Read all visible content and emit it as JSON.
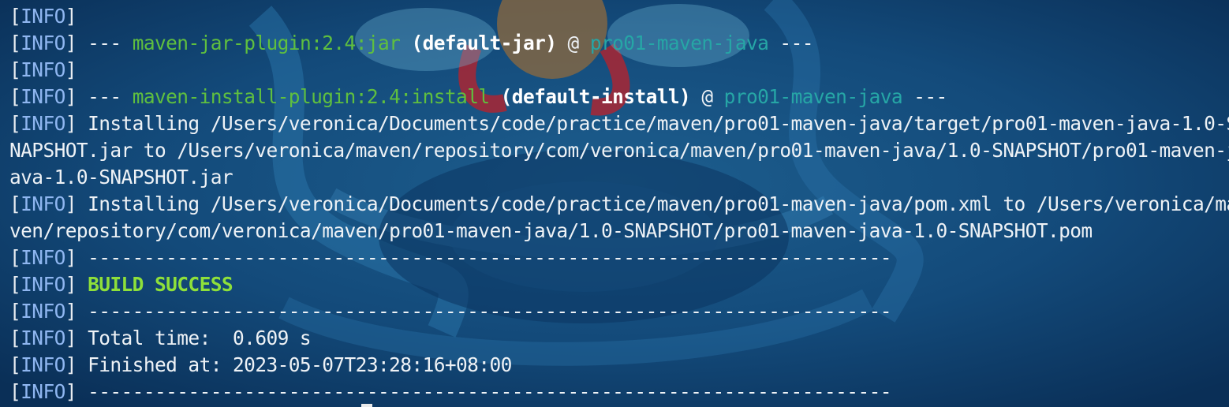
{
  "colors": {
    "background": "#0d3a66",
    "text": "#eef2f6",
    "info_level": "#8fb6f0",
    "plugin_green": "#5fbf3f",
    "project_cyan": "#26a6a6",
    "success_green": "#8ee03a"
  },
  "terminal": {
    "lines": [
      {
        "kind": "info",
        "level": "INFO",
        "text": ""
      },
      {
        "kind": "plugin",
        "level": "INFO",
        "dashes_open": " --- ",
        "plugin": "maven-jar-plugin:2.4:jar",
        "goal": " (default-jar)",
        "at": " @ ",
        "project": "pro01-maven-java",
        "dashes_close": " ---"
      },
      {
        "kind": "info",
        "level": "INFO",
        "text": ""
      },
      {
        "kind": "plugin",
        "level": "INFO",
        "dashes_open": " --- ",
        "plugin": "maven-install-plugin:2.4:install",
        "goal": " (default-install)",
        "at": " @ ",
        "project": "pro01-maven-java",
        "dashes_close": " ---"
      },
      {
        "kind": "info",
        "level": "INFO",
        "text": " Installing /Users/veronica/Documents/code/practice/maven/pro01-maven-java/target/pro01-maven-java-1.0-S"
      },
      {
        "kind": "plain",
        "text": "NAPSHOT.jar to /Users/veronica/maven/repository/com/veronica/maven/pro01-maven-java/1.0-SNAPSHOT/pro01-maven-j"
      },
      {
        "kind": "plain",
        "text": "ava-1.0-SNAPSHOT.jar"
      },
      {
        "kind": "info",
        "level": "INFO",
        "text": " Installing /Users/veronica/Documents/code/practice/maven/pro01-maven-java/pom.xml to /Users/veronica/ma"
      },
      {
        "kind": "plain",
        "text": "ven/repository/com/veronica/maven/pro01-maven-java/1.0-SNAPSHOT/pro01-maven-java-1.0-SNAPSHOT.pom"
      },
      {
        "kind": "info",
        "level": "INFO",
        "text": " ------------------------------------------------------------------------"
      },
      {
        "kind": "success",
        "level": "INFO",
        "text": "BUILD SUCCESS"
      },
      {
        "kind": "info",
        "level": "INFO",
        "text": " ------------------------------------------------------------------------"
      },
      {
        "kind": "info",
        "level": "INFO",
        "text": " Total time:  0.609 s"
      },
      {
        "kind": "info",
        "level": "INFO",
        "text": " Finished at: 2023-05-07T23:28:16+08:00"
      },
      {
        "kind": "info",
        "level": "INFO",
        "text": " ------------------------------------------------------------------------"
      }
    ]
  }
}
